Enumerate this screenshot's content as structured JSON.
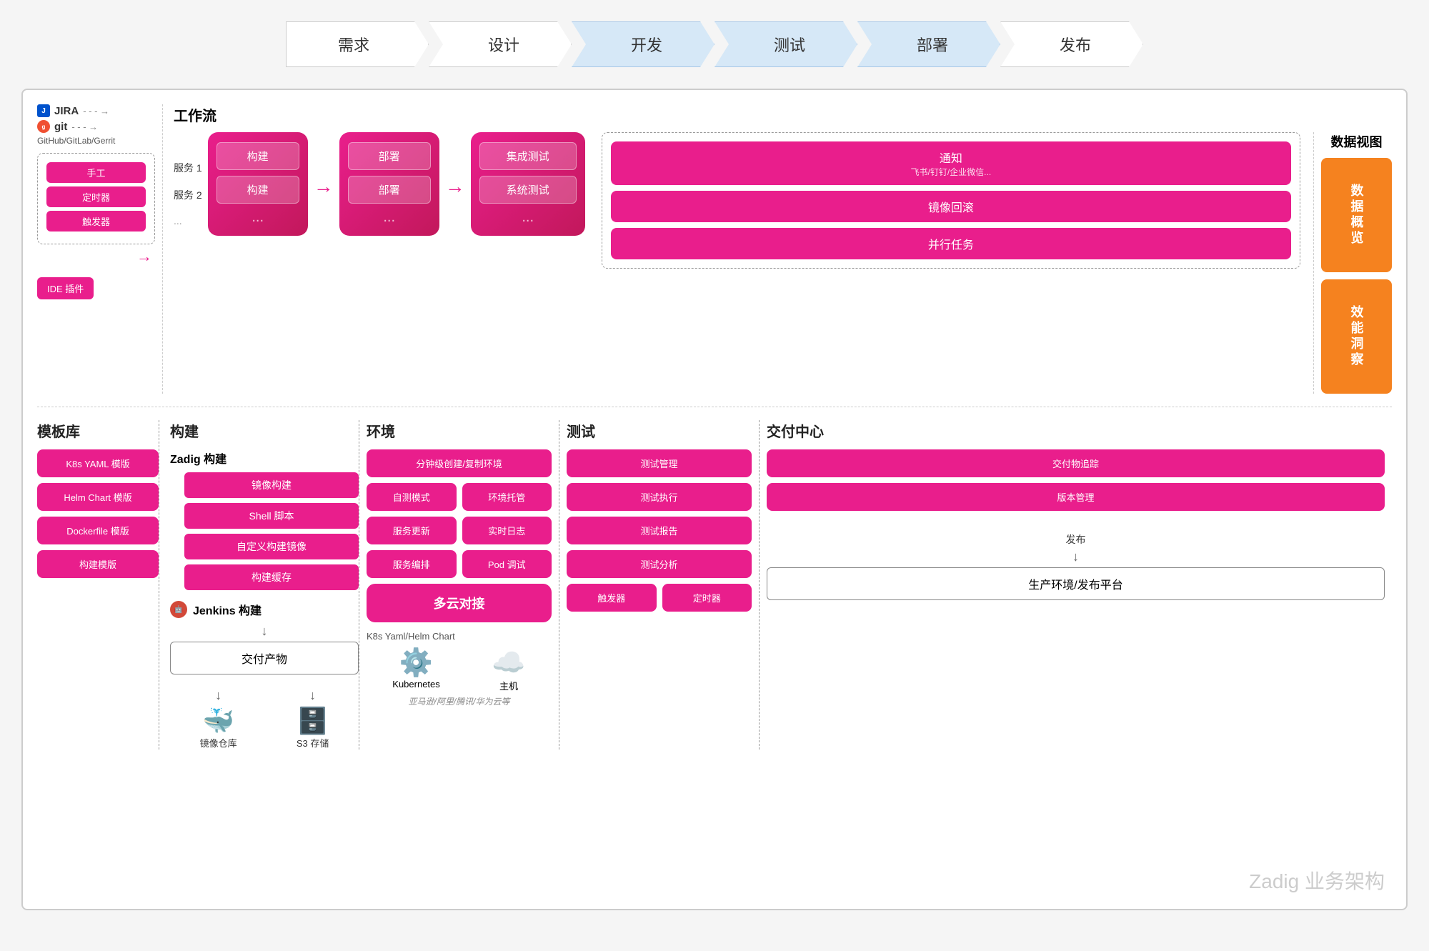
{
  "pipeline": {
    "steps": [
      {
        "label": "需求",
        "active": false
      },
      {
        "label": "设计",
        "active": false
      },
      {
        "label": "开发",
        "active": true
      },
      {
        "label": "测试",
        "active": true
      },
      {
        "label": "部署",
        "active": true
      },
      {
        "label": "发布",
        "active": false
      }
    ]
  },
  "workflow": {
    "title": "工作流",
    "service1": "服务 1",
    "service2": "服务 2",
    "dots": "...",
    "build_label": "构建",
    "deploy_label": "部署",
    "integration_test": "集成测试",
    "system_test": "系统测试"
  },
  "left_panel": {
    "jira_label": "JIRA",
    "git_label": "git",
    "github_label": "GitHub/GitLab/Gerrit",
    "trigger_items": [
      "手工",
      "定时器",
      "触发器"
    ],
    "ide_plugin": "IDE 插件"
  },
  "template_lib": {
    "title": "模板库",
    "items": [
      "K8s YAML 模版",
      "Helm Chart 模版",
      "Dockerfile 模版",
      "构建模版"
    ]
  },
  "build": {
    "title": "构建",
    "zadig_build_title": "Zadig 构建",
    "zadig_items": [
      "镜像构建",
      "Shell 脚本",
      "自定义构建镜像",
      "构建缓存"
    ],
    "jenkins_title": "Jenkins 构建",
    "artifact_label": "交付产物",
    "image_repo": "镜像仓库",
    "s3_storage": "S3 存储"
  },
  "environment": {
    "title": "环境",
    "items_full": [
      "分钟级创建/复制环境"
    ],
    "items_two_col": [
      [
        "自测模式",
        "环境托管"
      ],
      [
        "服务更新",
        "实时日志"
      ],
      [
        "服务编排",
        "Pod 调试"
      ]
    ],
    "multi_cloud": "多云对接",
    "k8s_label": "K8s Yaml/Helm Chart",
    "kubernetes_label": "Kubernetes",
    "host_label": "主机",
    "cloud_providers": "亚马逊/阿里/腾讯/华为云等"
  },
  "test": {
    "title": "测试",
    "items": [
      "测试管理",
      "测试执行",
      "测试报告",
      "测试分析"
    ],
    "items_two_col": [
      [
        "触发器",
        "定时器"
      ]
    ]
  },
  "delivery": {
    "title": "交付中心",
    "items": [
      "交付物追踪",
      "版本管理"
    ],
    "publish_label": "发布",
    "production_label": "生产环境/发布平台"
  },
  "notifications": {
    "title": "通知",
    "subtitle": "飞书/钉钉/企业微信...",
    "rollback": "镜像回滚",
    "parallel": "并行任务"
  },
  "data_view": {
    "title": "数据视图",
    "overview": "数据概览",
    "insights": "效能洞察"
  },
  "footer": {
    "label": "Zadig 业务架构"
  }
}
